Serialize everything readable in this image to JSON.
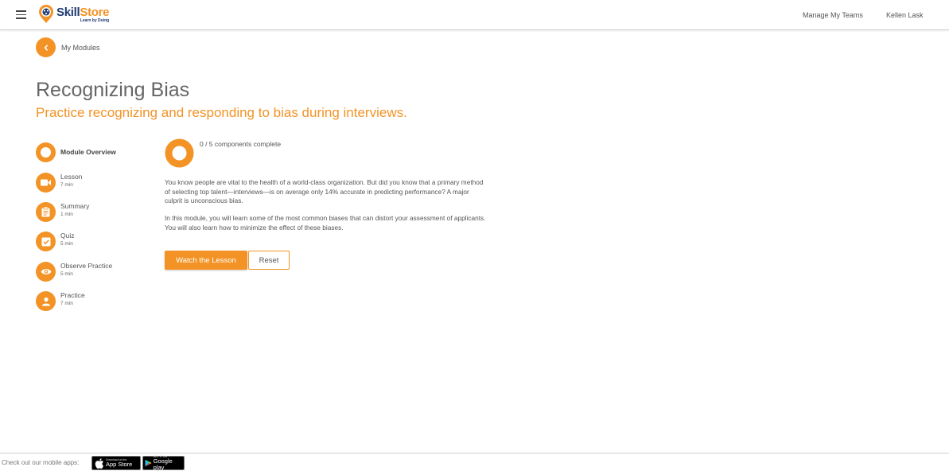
{
  "header": {
    "logo": {
      "name_part1": "Skill",
      "name_part2": "Store",
      "tagline": "Learn by Doing"
    },
    "nav": {
      "manage_teams": "Manage My Teams",
      "user_name": "Kellen Lask"
    }
  },
  "breadcrumb": {
    "back_label": "My Modules"
  },
  "module": {
    "title": "Recognizing Bias",
    "subtitle": "Practice recognizing and responding to bias during interviews."
  },
  "sidebar": {
    "items": [
      {
        "label": "Module Overview",
        "duration": "",
        "icon": "circle-icon"
      },
      {
        "label": "Lesson",
        "duration": "7 min",
        "icon": "video-camera-icon"
      },
      {
        "label": "Summary",
        "duration": "1 min",
        "icon": "clipboard-icon"
      },
      {
        "label": "Quiz",
        "duration": "5 min",
        "icon": "checkbox-icon"
      },
      {
        "label": "Observe Practice",
        "duration": "5 min",
        "icon": "eye-icon"
      },
      {
        "label": "Practice",
        "duration": "7 min",
        "icon": "person-icon"
      }
    ]
  },
  "overview": {
    "progress_text": "0 / 5 components complete",
    "progress_value": 0,
    "paragraph1": "You know people are vital to the health of a world-class organization. But did you know that a primary method of selecting top talent—interviews—is on average only 14% accurate in predicting performance? A major culprit is unconscious bias.",
    "paragraph2": "In this module, you will learn some of the most common biases that can distort your assessment of applicants. You will also learn how to minimize the effect of these biases.",
    "primary_button": "Watch the Lesson",
    "secondary_button": "Reset"
  },
  "footer": {
    "text": "Check out our mobile apps:",
    "apple_small": "Download on the",
    "apple_big": "App Store",
    "google_small": "GET IT ON",
    "google_big": "Google play"
  },
  "colors": {
    "accent": "#f39325",
    "brand_navy": "#1f3b73"
  }
}
